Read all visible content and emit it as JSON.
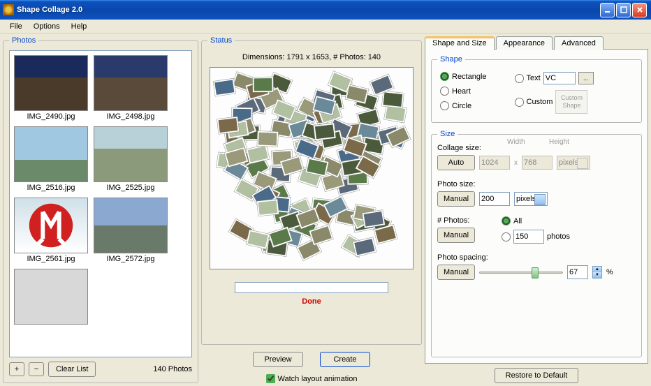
{
  "window": {
    "title": "Shape Collage 2.0"
  },
  "menu": {
    "file": "File",
    "options": "Options",
    "help": "Help"
  },
  "photos": {
    "legend": "Photos",
    "items": [
      {
        "label": "IMG_2490.jpg",
        "variant": "v1"
      },
      {
        "label": "IMG_2498.jpg",
        "variant": "v2"
      },
      {
        "label": "IMG_2516.jpg",
        "variant": "v3"
      },
      {
        "label": "IMG_2525.jpg",
        "variant": "v4"
      },
      {
        "label": "IMG_2561.jpg",
        "variant": "v5"
      },
      {
        "label": "IMG_2572.jpg",
        "variant": "v6"
      },
      {
        "label": "",
        "variant": "v7"
      }
    ],
    "add": "+",
    "remove": "−",
    "clear": "Clear List",
    "count": "140 Photos"
  },
  "status": {
    "legend": "Status",
    "dimensions": "Dimensions: 1791 x 1653, # Photos: 140",
    "done": "Done",
    "preview": "Preview",
    "create": "Create",
    "watch": "Watch layout animation"
  },
  "tabs": {
    "shape": "Shape and Size",
    "appearance": "Appearance",
    "advanced": "Advanced"
  },
  "shape": {
    "legend": "Shape",
    "rectangle": "Rectangle",
    "heart": "Heart",
    "circle": "Circle",
    "text": "Text",
    "custom": "Custom",
    "text_value": "VC",
    "browse": "...",
    "custom_placeholder": "Custom Shape"
  },
  "size": {
    "legend": "Size",
    "collage_label": "Collage size:",
    "auto": "Auto",
    "manual": "Manual",
    "width_label": "Width",
    "height_label": "Height",
    "width": "1024",
    "height": "768",
    "x": "x",
    "unit": "pixels",
    "photo_label": "Photo size:",
    "photo_value": "200",
    "numphotos_label": "# Photos:",
    "all": "All",
    "numphotos_value": "150",
    "photos_word": "photos",
    "spacing_label": "Photo spacing:",
    "spacing_value": "67",
    "percent": "%"
  },
  "restore": "Restore to Default"
}
